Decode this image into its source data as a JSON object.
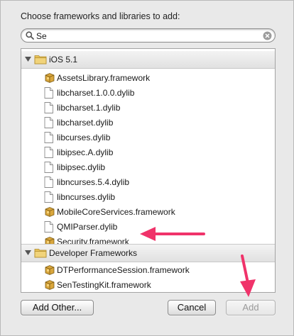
{
  "dialog": {
    "prompt": "Choose frameworks and libraries to add:"
  },
  "search": {
    "value": "Se"
  },
  "groups": [
    {
      "title": "iOS 5.1",
      "items": [
        {
          "label": "AssetsLibrary.framework",
          "icon": "framework-icon"
        },
        {
          "label": "libcharset.1.0.0.dylib",
          "icon": "file-icon"
        },
        {
          "label": "libcharset.1.dylib",
          "icon": "file-icon"
        },
        {
          "label": "libcharset.dylib",
          "icon": "file-icon"
        },
        {
          "label": "libcurses.dylib",
          "icon": "file-icon"
        },
        {
          "label": "libipsec.A.dylib",
          "icon": "file-icon"
        },
        {
          "label": "libipsec.dylib",
          "icon": "file-icon"
        },
        {
          "label": "libncurses.5.4.dylib",
          "icon": "file-icon"
        },
        {
          "label": "libncurses.dylib",
          "icon": "file-icon"
        },
        {
          "label": "MobileCoreServices.framework",
          "icon": "framework-icon"
        },
        {
          "label": "QMIParser.dylib",
          "icon": "file-icon"
        },
        {
          "label": "Security.framework",
          "icon": "framework-icon"
        }
      ]
    },
    {
      "title": "Developer Frameworks",
      "items": [
        {
          "label": "DTPerformanceSession.framework",
          "icon": "framework-icon"
        },
        {
          "label": "SenTestingKit.framework",
          "icon": "framework-icon"
        }
      ]
    }
  ],
  "buttons": {
    "add_other": "Add Other...",
    "cancel": "Cancel",
    "add": "Add"
  },
  "colors": {
    "annotation_arrow": "#f0336a",
    "folder": "#e8c35a"
  }
}
